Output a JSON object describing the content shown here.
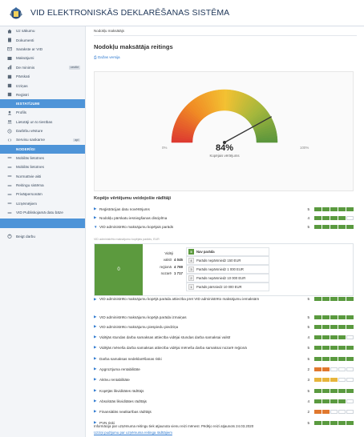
{
  "app": {
    "title": "VID ELEKTRONISKĀS DEKLARĒŠANAS SISTĒMA"
  },
  "sidebar": {
    "items_top": [
      {
        "label": "Uz sākumu",
        "icon": "home-icon"
      },
      {
        "label": "Dokumenti",
        "icon": "document-icon"
      },
      {
        "label": "Sarakste ar VID",
        "icon": "mail-icon"
      },
      {
        "label": "Maksājumi",
        "icon": "payment-icon"
      },
      {
        "label": "De minimis",
        "icon": "chart-icon",
        "badge": "uzsākt"
      },
      {
        "label": "Pārskati",
        "icon": "report-icon"
      },
      {
        "label": "Izziņas",
        "icon": "certificate-icon"
      },
      {
        "label": "Reģistri",
        "icon": "registry-icon"
      }
    ],
    "settings_label": "IESTATĪJUMI",
    "items_settings": [
      {
        "label": "Profils",
        "icon": "user-icon"
      },
      {
        "label": "Lietotāji un to tiesības",
        "icon": "users-icon"
      },
      {
        "label": "Darbību vēsture",
        "icon": "history-icon"
      },
      {
        "label": "Servisu saskarne",
        "icon": "api-icon",
        "badge": "api"
      }
    ],
    "useful_label": "NODERĪGI",
    "items_useful": [
      {
        "label": "Mobilās lietotnes",
        "icon": "link-icon"
      },
      {
        "label": "Mobilās lietotnes",
        "icon": "link-icon"
      },
      {
        "label": "Normatīvie akti",
        "icon": "link-icon"
      },
      {
        "label": "Reitingu sistēma",
        "icon": "link-icon"
      },
      {
        "label": "Privātpersonām",
        "icon": "link-icon"
      },
      {
        "label": "Uzņēmējiem",
        "icon": "link-icon"
      },
      {
        "label": "VID Publiskojamā datu bāze",
        "icon": "link-icon"
      }
    ],
    "logout_label": "Beigt darbu"
  },
  "main": {
    "breadcrumb": "Nodokļu maksātājs",
    "title": "Nodokļu maksātāja reitings",
    "back_label": "Dažas versija",
    "gauge": {
      "value": "84%",
      "fraction": 0.84,
      "caption": "Kopējais vērtējums",
      "min_label": "0%",
      "max_label": "100%",
      "colors": [
        "#dd3b30",
        "#f08a24",
        "#f3c132",
        "#a5b73c",
        "#57943c"
      ]
    },
    "indicators_title": "Kopējo vērtējumu veidojošie rādītāji",
    "indicators_top": [
      {
        "label": "Reģistrācijas datu novērtējums",
        "score": "5",
        "level": 5,
        "color": "g",
        "open": false
      },
      {
        "label": "Nodokļu pārskatu iesniegšanas disciplīna",
        "score": "4",
        "level": 4,
        "color": "g",
        "open": false
      },
      {
        "label": "VID administrēto maksājumu kopējais parāds",
        "score": "5",
        "level": 5,
        "color": "g",
        "open": true
      }
    ],
    "row_note": "VID administrēto maksājumu kopējais parāds, EUR",
    "detail": {
      "green_value": "0",
      "stats_head": "Vidēji",
      "stats": [
        {
          "label": "valstī",
          "value": "4 045"
        },
        {
          "label": "reģionā",
          "value": "4 769"
        },
        {
          "label": "nozarē",
          "value": "1 717"
        }
      ],
      "levels": [
        {
          "num": "5",
          "label": "Nav parāda",
          "active": true
        },
        {
          "num": "4",
          "label": "Parāds nepārsniedz 150 EUR",
          "active": false
        },
        {
          "num": "3",
          "label": "Parāds nepārsniedz 1 000 EUR",
          "active": false
        },
        {
          "num": "2",
          "label": "Parāds nepārsniedz 10 000 EUR",
          "active": false
        },
        {
          "num": "1",
          "label": "Parāds pārsniedz 10 000 EUR",
          "active": false
        }
      ]
    },
    "indicators_bottom": [
      {
        "label": "VID administrēto maksājumu kopējā parāda attiecība pret VID administrēto maksājumu iemaksām",
        "score": "5",
        "level": 5,
        "color": "g"
      },
      {
        "label": "VID administrēto maksājumu kopējā parāda izmaiņas",
        "score": "5",
        "level": 5,
        "color": "g"
      },
      {
        "label": "VID administrēto maksājumu piespiedu piedziņa",
        "score": "5",
        "level": 5,
        "color": "g"
      },
      {
        "label": "Vidējās stundas darba samaksas attiecība vidējai stundas darba samaksai valstī",
        "score": "4",
        "level": 4,
        "color": "g"
      },
      {
        "label": "Vidējās mēneša darba samaksas attiecība vidējai mēneša darba samaksai nozarē reģionā",
        "score": "5",
        "level": 5,
        "color": "g"
      },
      {
        "label": "Darba samaksas nedeklarēšanas riski",
        "score": "5",
        "level": 5,
        "color": "g"
      },
      {
        "label": "Apgrozījuma rentabilitāte",
        "score": "2",
        "level": 2,
        "color": "o"
      },
      {
        "label": "Aktīvu rentabilitāte",
        "score": "3",
        "level": 3,
        "color": "y"
      },
      {
        "label": "Kopējās likviditātes rādītājs",
        "score": "5",
        "level": 5,
        "color": "g"
      },
      {
        "label": "Absolūtās likviditātes rādītājs",
        "score": "4",
        "level": 4,
        "color": "g"
      },
      {
        "label": "Finansiālās neatkarības rādītājs",
        "score": "2",
        "level": 2,
        "color": "o"
      },
      {
        "label": "PVN riski",
        "score": "5",
        "level": 5,
        "color": "g"
      }
    ],
    "footer_text": "Informācija par uzņēmuma reitingu tiek atjaunota vienu reizi mēnesī. Pēdējo reizi atjaunots 24.03.2020",
    "footer_link": "Uzziņi pudījumu par uzņēmuma reitinga rādītājiem"
  }
}
